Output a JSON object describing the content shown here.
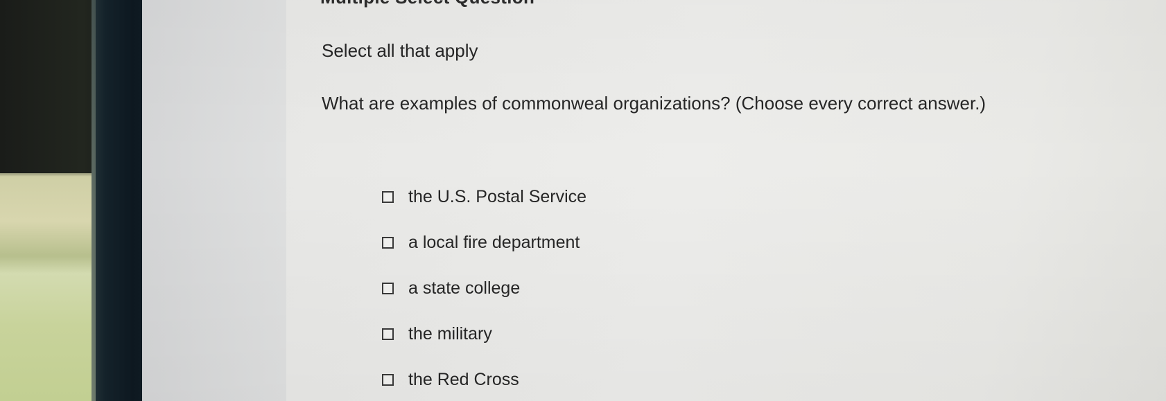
{
  "question": {
    "heading": "Multiple Select Question",
    "instruction": "Select all that apply",
    "prompt": "What are examples of commonweal organizations? (Choose every correct answer.)",
    "options": [
      {
        "label": "the U.S. Postal Service",
        "checked": false
      },
      {
        "label": "a local fire department",
        "checked": false
      },
      {
        "label": "a state college",
        "checked": false
      },
      {
        "label": "the military",
        "checked": false
      },
      {
        "label": "the Red Cross",
        "checked": false
      }
    ]
  },
  "colors": {
    "text": "#262626",
    "screen_background": "#ebebe9",
    "sidebar_background": "#dadbdc",
    "bezel": "#0d1820"
  }
}
